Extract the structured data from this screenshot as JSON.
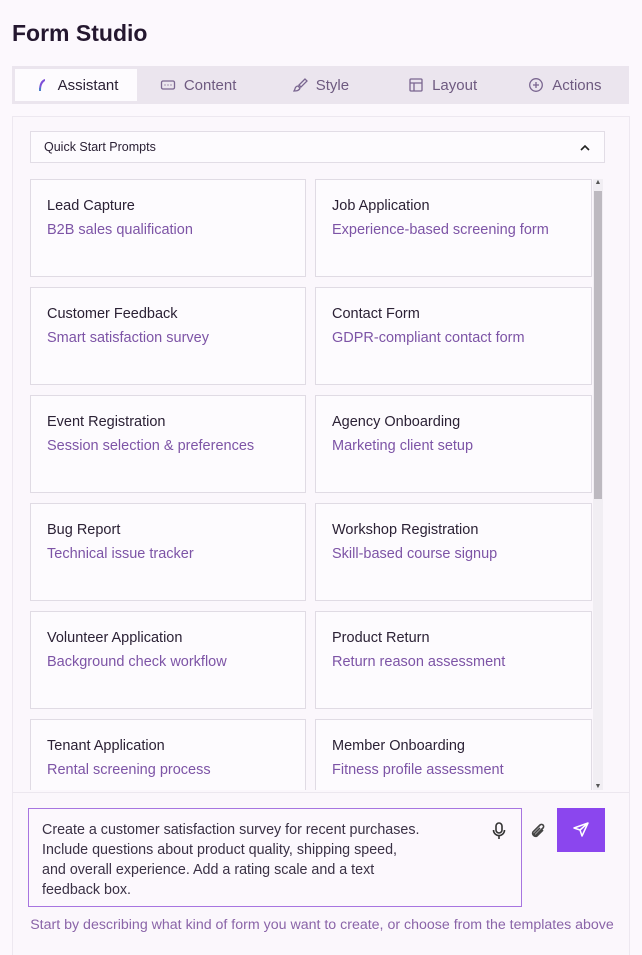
{
  "app": {
    "title": "Form Studio"
  },
  "tabs": [
    {
      "label": "Assistant",
      "icon": "feather-icon",
      "active": true
    },
    {
      "label": "Content",
      "icon": "text-field-icon"
    },
    {
      "label": "Style",
      "icon": "paintbrush-icon"
    },
    {
      "label": "Layout",
      "icon": "layout-icon"
    },
    {
      "label": "Actions",
      "icon": "plus-circle-icon"
    }
  ],
  "quick_start": {
    "label": "Quick Start Prompts",
    "icon": "chevron-up-icon"
  },
  "templates": [
    {
      "name": "Lead Capture",
      "desc": "B2B sales qualification"
    },
    {
      "name": "Job Application",
      "desc": "Experience-based screening form"
    },
    {
      "name": "Customer Feedback",
      "desc": "Smart satisfaction survey"
    },
    {
      "name": "Contact Form",
      "desc": "GDPR-compliant contact form"
    },
    {
      "name": "Event Registration",
      "desc": "Session selection & preferences"
    },
    {
      "name": "Agency Onboarding",
      "desc": "Marketing client setup"
    },
    {
      "name": "Bug Report",
      "desc": "Technical issue tracker"
    },
    {
      "name": "Workshop Registration",
      "desc": "Skill-based course signup"
    },
    {
      "name": "Volunteer Application",
      "desc": "Background check workflow"
    },
    {
      "name": "Product Return",
      "desc": "Return reason assessment"
    },
    {
      "name": "Tenant Application",
      "desc": "Rental screening process"
    },
    {
      "name": "Member Onboarding",
      "desc": "Fitness profile assessment"
    }
  ],
  "prompt": {
    "value": "Create a customer satisfaction survey for recent purchases.\nInclude questions about product quality, shipping speed,\nand overall experience. Add a rating scale and a text\nfeedback box."
  },
  "hint": "Start by describing what kind of form you want to create, or choose from the templates above",
  "colors": {
    "accent": "#8b46ee",
    "subtitle": "#7d54a6",
    "tabbar": "#ebe5ee"
  }
}
